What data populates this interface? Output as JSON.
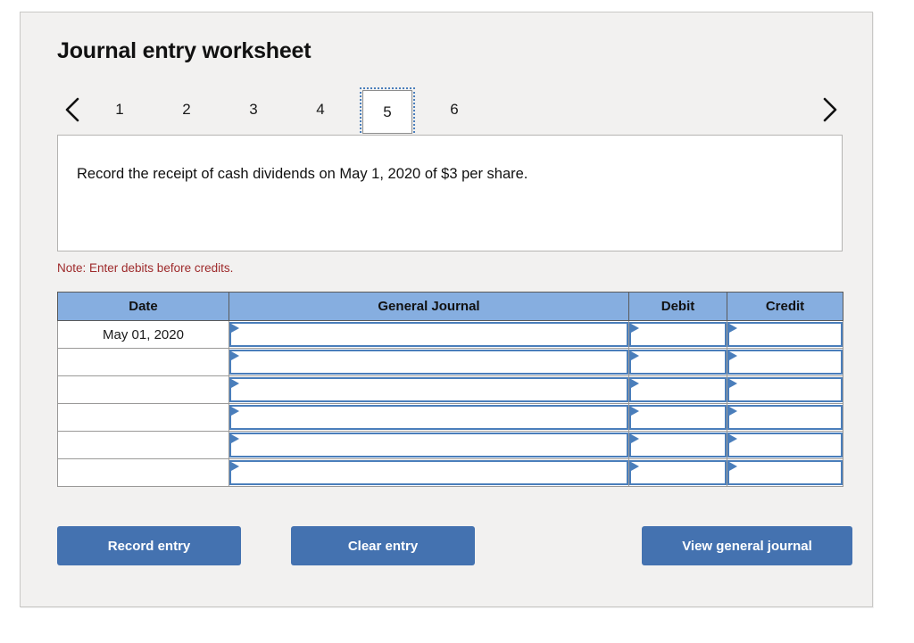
{
  "page_title": "Journal entry worksheet",
  "pager": {
    "prev_icon": "chevron-left-icon",
    "next_icon": "chevron-right-icon",
    "pages": [
      "1",
      "2",
      "3",
      "4",
      "5",
      "6"
    ],
    "active_page": "5"
  },
  "instruction": {
    "text": "Record the receipt of cash dividends on May 1, 2020 of $3 per share."
  },
  "note": "Note: Enter debits before credits.",
  "table": {
    "headers": [
      "Date",
      "General Journal",
      "Debit",
      "Credit"
    ],
    "rows": [
      {
        "date": "May 01, 2020",
        "general_journal": "",
        "debit": "",
        "credit": ""
      },
      {
        "date": "",
        "general_journal": "",
        "debit": "",
        "credit": ""
      },
      {
        "date": "",
        "general_journal": "",
        "debit": "",
        "credit": ""
      },
      {
        "date": "",
        "general_journal": "",
        "debit": "",
        "credit": ""
      },
      {
        "date": "",
        "general_journal": "",
        "debit": "",
        "credit": ""
      },
      {
        "date": "",
        "general_journal": "",
        "debit": "",
        "credit": ""
      }
    ]
  },
  "buttons": {
    "record": "Record entry",
    "clear": "Clear entry",
    "view": "View general journal"
  },
  "colors": {
    "header_blue": "#86aee0",
    "button_blue": "#4472b0",
    "field_border_blue": "#4a7ebb",
    "note_red": "#9e2a2b",
    "panel_bg": "#f2f1f0"
  }
}
